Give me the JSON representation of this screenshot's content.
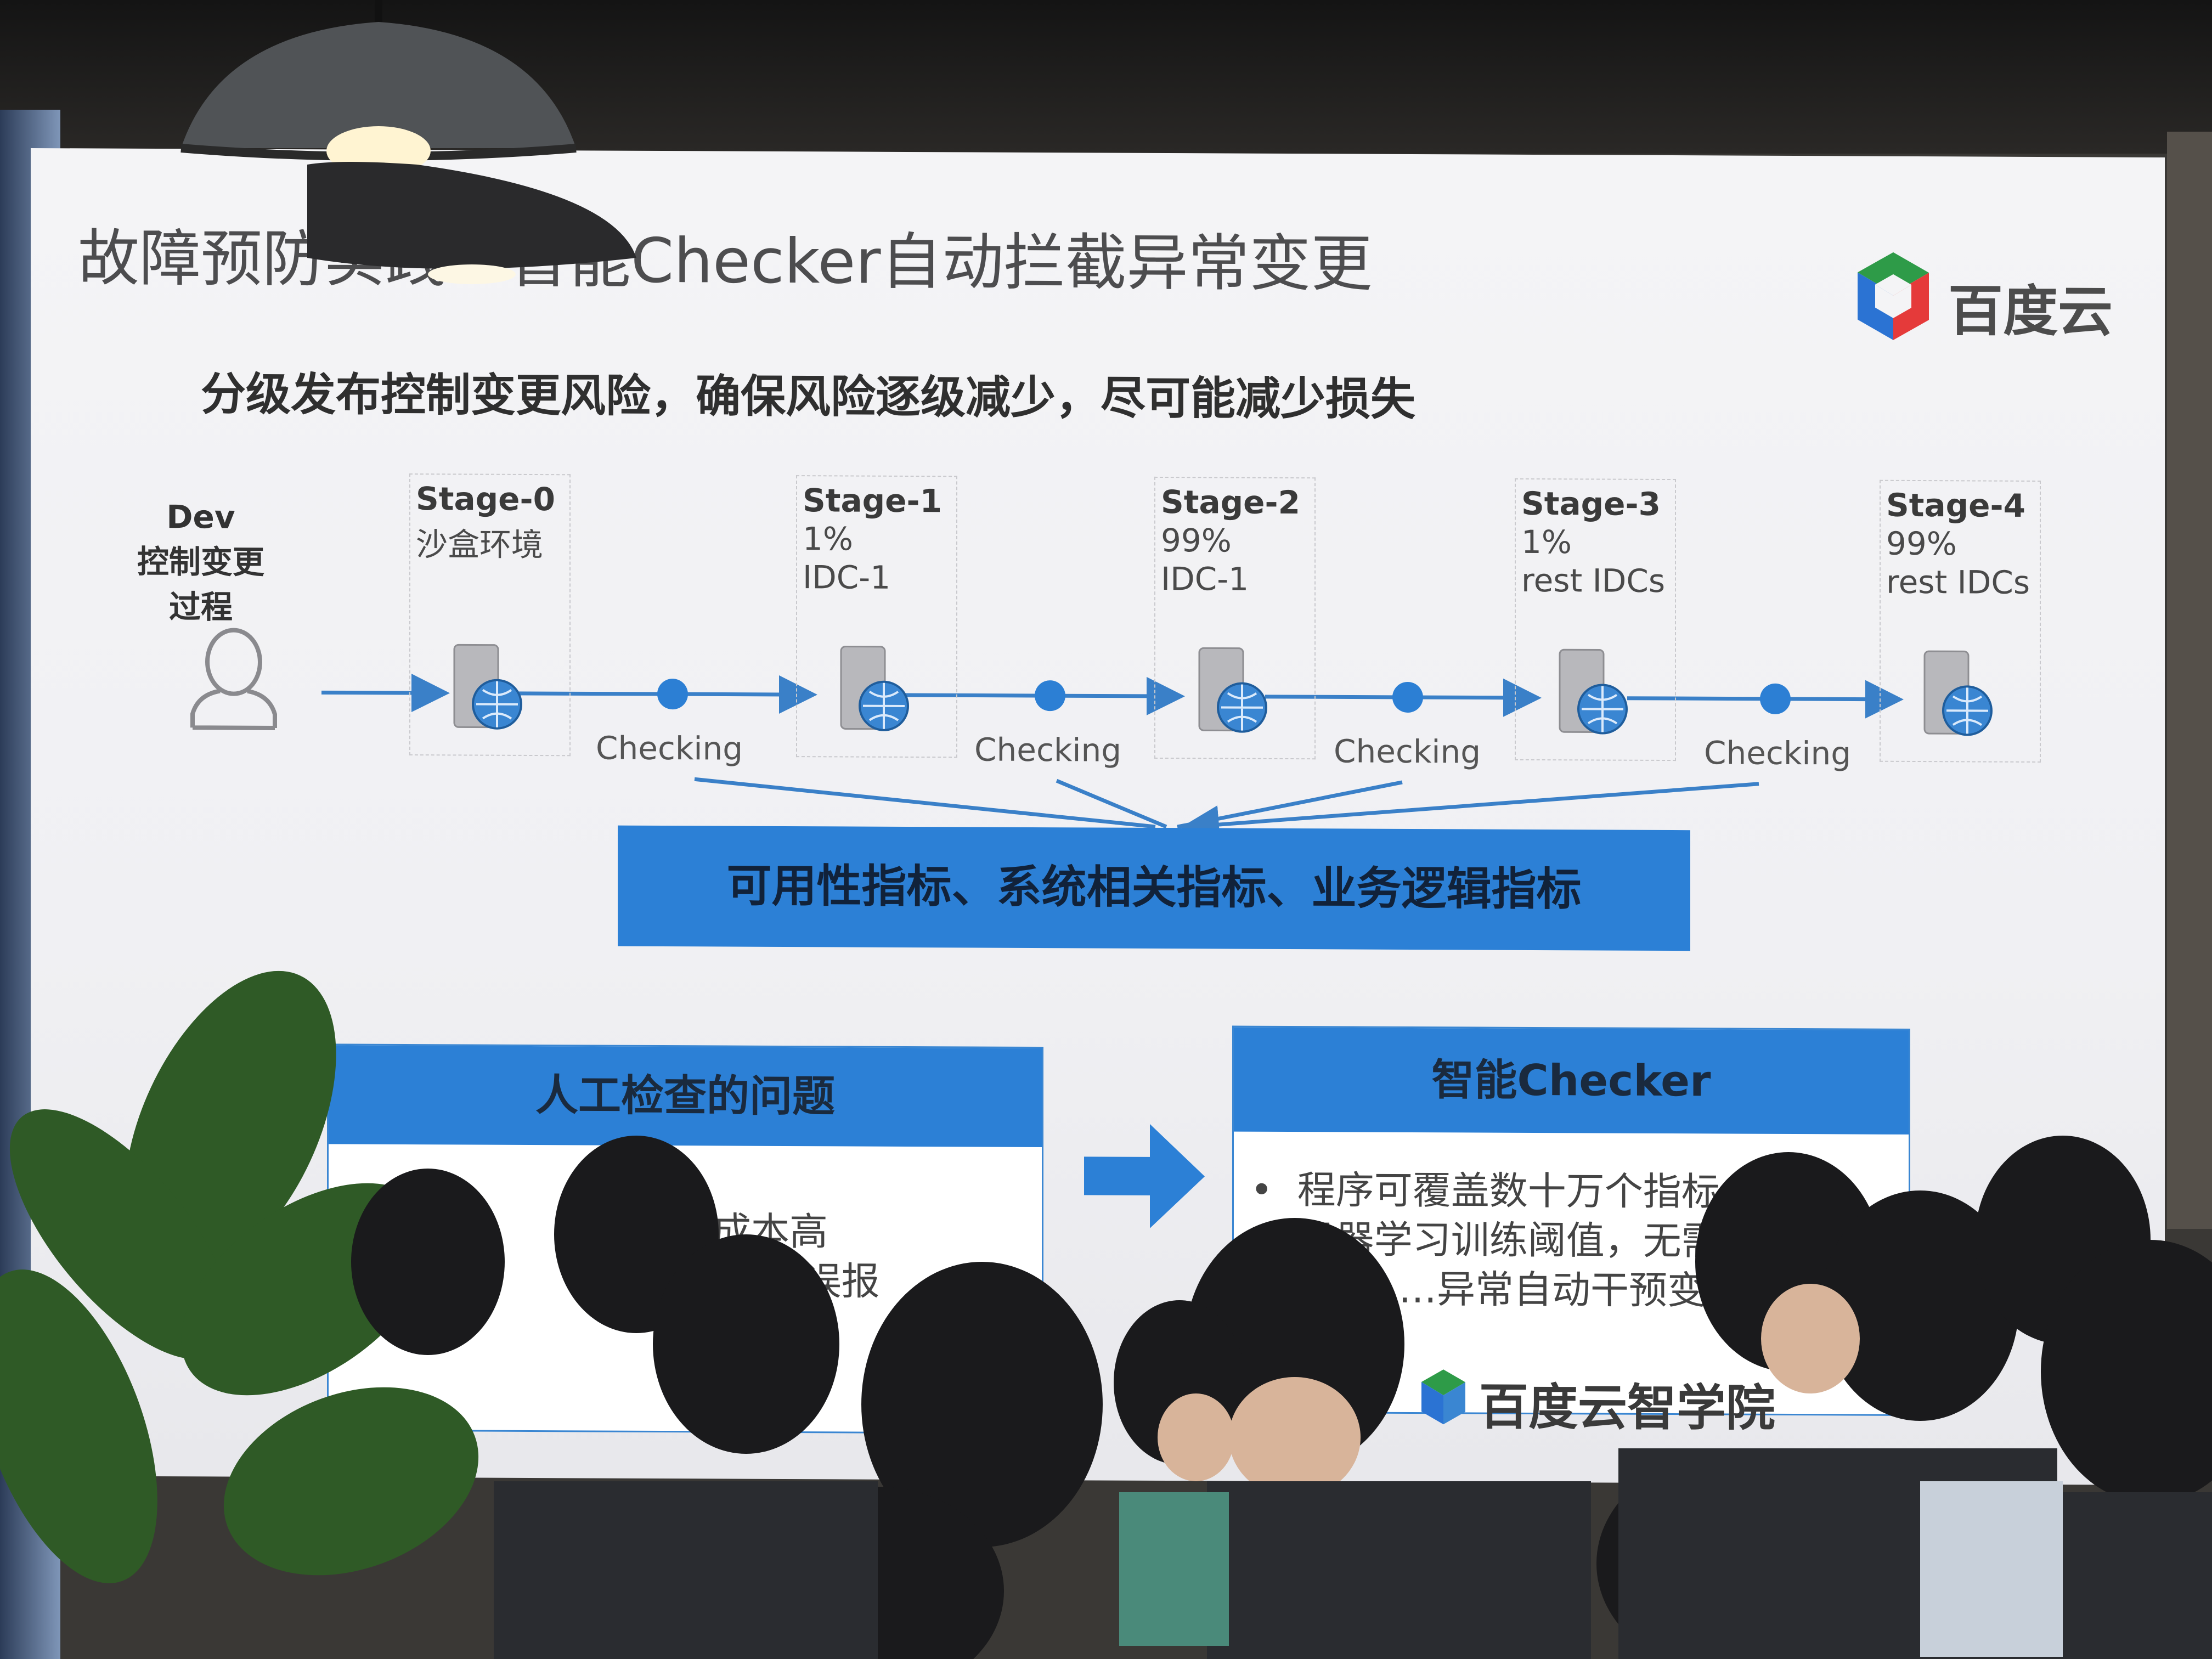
{
  "slide": {
    "title": "故障预防实践：智能Checker自动拦截异常变更",
    "logo_text": "百度云",
    "subtitle": "分级发布控制变更风险，确保风险逐级减少，尽可能减少损失",
    "dev": {
      "line1": "Dev",
      "line2": "控制变更过程"
    },
    "stages": [
      {
        "title": "Stage-0",
        "line1": "沙盒环境",
        "line2": ""
      },
      {
        "title": "Stage-1",
        "line1": "1%",
        "line2": "IDC-1"
      },
      {
        "title": "Stage-2",
        "line1": "99%",
        "line2": "IDC-1"
      },
      {
        "title": "Stage-3",
        "line1": "1%",
        "line2": "rest IDCs"
      },
      {
        "title": "Stage-4",
        "line1": "99%",
        "line2": "rest IDCs"
      }
    ],
    "checking_labels": [
      "Checking",
      "Checking",
      "Checking",
      "Checking"
    ],
    "metrics": "可用性指标、系统相关指标、业务逻辑指标",
    "left_panel": {
      "header": "人工检查的问题",
      "bullets": [
        "…覆盖…成本高",
        "…漏报&误报"
      ]
    },
    "right_panel": {
      "header": "智能Checker",
      "bullets": [
        "程序可覆盖数十万个指标",
        "机器学习训练阈值，无需…",
        "…异常自动干预变更"
      ]
    },
    "watermark": "百度云智学院"
  },
  "colors": {
    "accent_blue": "#2c80d6",
    "screen_bg": "#f2f2f4",
    "text_gray": "#4d4d4f"
  }
}
